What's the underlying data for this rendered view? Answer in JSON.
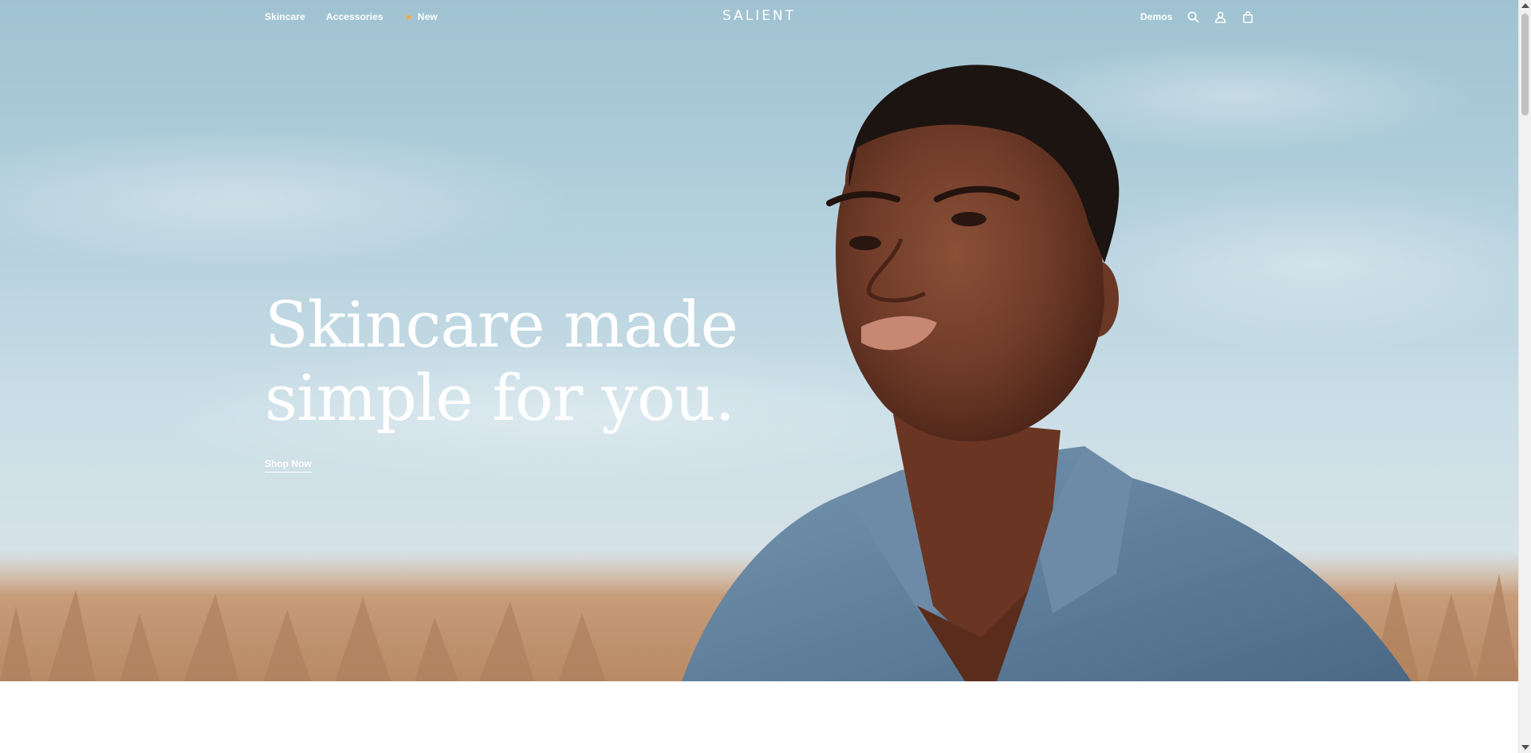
{
  "header": {
    "nav_left": [
      {
        "label": "Skincare"
      },
      {
        "label": "Accessories"
      },
      {
        "label": "New",
        "icon": "sparkle-icon"
      }
    ],
    "logo": "SALIENT",
    "nav_right": {
      "demos_label": "Demos",
      "icons": [
        "search-icon",
        "account-icon",
        "cart-icon"
      ]
    }
  },
  "hero": {
    "title_line1": "Skincare made",
    "title_line2": "simple for you.",
    "cta_label": "Shop Now"
  },
  "colors": {
    "nav_text": "#ffffff",
    "sky": "#b7d3df",
    "sparkle": "#f2a74b"
  }
}
